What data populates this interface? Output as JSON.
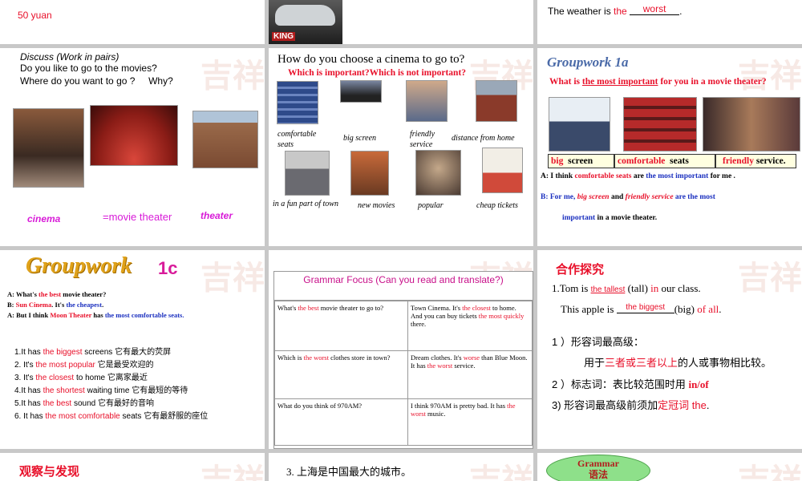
{
  "slide1": {
    "price": "50 yuan"
  },
  "slide2": {
    "logo": "KING"
  },
  "slide3": {
    "prefix": "The weather is ",
    "the": "the",
    "answer": "worst",
    "end": "."
  },
  "slide4": {
    "title": "Discuss (Work in pairs)",
    "q1": "Do you like to go to the movies?",
    "q2": "Where do you want to go ?     Why?",
    "cinema": "cinema",
    "movie_theater": "=movie theater",
    "theater": "theater"
  },
  "slide5": {
    "title": "How do you choose a cinema to go to?",
    "subtitle": "Which is important?Which is not important?",
    "items": [
      "comfortable seats",
      "big screen",
      "friendly service",
      "distance from home",
      "in a fun part of town",
      "new movies",
      "popular",
      "cheap tickets"
    ]
  },
  "slide6": {
    "title": "Groupwork 1a",
    "question_pre": "What is ",
    "question_ul": "the most important",
    "question_post": " for you in a movie theater?",
    "opt1a": "big",
    "opt1b": "screen",
    "opt2a": "comfortable",
    "opt2b": "seats",
    "opt3a": "friendly",
    "opt3b": "service.",
    "a_pre": "A: I think ",
    "a_red": "comfortable seats",
    "a_mid": " are ",
    "a_blue": "the most important",
    "a_post": " for me .",
    "b_pre": "B: For me, ",
    "b_red1": "big screen",
    "b_and": " and ",
    "b_red2": "friendly service",
    "b_blue": " are the most",
    "b2_blue": "important",
    "b2_post": " in a movie theater."
  },
  "slide7": {
    "title_a": "Groupwork",
    "title_b": "1c",
    "l1_pre": "A: What's ",
    "l1_red": "the best",
    "l1_post": " movie theater?",
    "l2_pre": "B: ",
    "l2_red": "Sun Cinema",
    "l2_mid": ". It's ",
    "l2_blue": "the cheapest",
    "l2_post": ".",
    "l3_pre": "A: But I think ",
    "l3_red": "Moon Theater",
    "l3_mid": " has ",
    "l3_blue": "the most",
    "l3_post": "  comfortable seats.",
    "list": [
      {
        "pre": "1.It has ",
        "red": "the biggest",
        "post": " screens   它有最大的荧屏"
      },
      {
        "pre": "2. It's ",
        "red": "the most popular",
        "post": " 它是最受欢迎的"
      },
      {
        "pre": "3. It's ",
        "red": "the closest",
        "post": " to home   它离家最近"
      },
      {
        "pre": "4.It has ",
        "red": "the shortest",
        "post": " waiting time  它有最短的等待"
      },
      {
        "pre": "5.It has ",
        "red": "the best",
        "post": " sound   它有最好的音响"
      },
      {
        "pre": "6. It has ",
        "red": "the most comfortable",
        "post": " seats   它有最舒服的座位"
      }
    ]
  },
  "slide8": {
    "title": "Grammar Focus (Can you read and translate?)",
    "rows": [
      {
        "q_pre": "What's ",
        "q_red": "the best",
        "q_post": " movie theater to go to?",
        "a_pre": "Town Cinema. It's ",
        "a_red": "the closest",
        "a_mid": " to home. And you can buy tickets ",
        "a_red2": "the most quickly",
        "a_post": " there."
      },
      {
        "q_pre": "Which is ",
        "q_red": "the worst",
        "q_post": " clothes store in town?",
        "a_pre": "Dream clothes. It's ",
        "a_red": "worse",
        "a_mid": " than Blue Moon. It has ",
        "a_red2": "the worst",
        "a_post": " service."
      },
      {
        "q_pre": "What do you think of 970AM?",
        "q_red": "",
        "q_post": "",
        "a_pre": "I think 970AM is pretty bad. It has ",
        "a_red": "the worst",
        "a_mid": " music.",
        "a_red2": "",
        "a_post": ""
      }
    ]
  },
  "slide9": {
    "title": "合作探究",
    "l1_pre": "1.Tom is ",
    "l1_ans": "the tallest",
    "l1_mid": " (tall) ",
    "l1_in": "in",
    "l1_post": " our class.",
    "l2_pre": "This apple is ",
    "l2_ans": "the biggest",
    "l2_mid": "(big) ",
    "l2_red": "of all",
    "l2_post": ".",
    "r1": "1 ）形容词最高级：",
    "r2_pre": "用于",
    "r2_red": "三者或三者以上",
    "r2_post": "的人或事物相比较。",
    "r3_pre": "2 ）标志词：表比较范围时用 ",
    "r3_red": "in/of",
    "r4_pre": "3)    形容词最高级前须加",
    "r4_red": "定冠词 the",
    "r4_post": "."
  },
  "slide10": {
    "title": "观察与发现"
  },
  "slide11": {
    "text": "3. 上海是中国最大的城市。"
  },
  "slide12": {
    "btn1": "Grammar",
    "btn2": "语法"
  },
  "watermark": "吉祥"
}
